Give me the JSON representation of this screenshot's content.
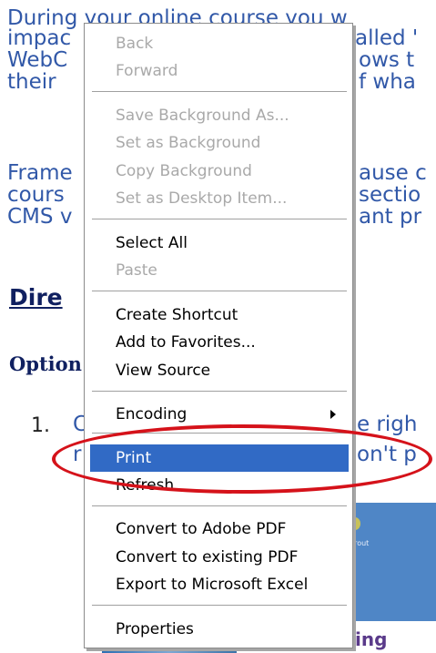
{
  "background_page": {
    "paragraph1_lines": [
      "During your online course you w",
      "impac",
      "WebC",
      "their"
    ],
    "paragraph1_right": [
      "alled '",
      "ows t",
      "f wha"
    ],
    "paragraph2_lines": [
      "Frame",
      "cours",
      "CMS v"
    ],
    "paragraph2_right": [
      "ause c",
      "sectio",
      "ant pr"
    ],
    "heading": "Dire",
    "subheading": "Option",
    "list_number": "1.",
    "list_first_letter": "C",
    "list_line1_right": "e righ",
    "list_line2_left": "r",
    "list_line2_right": "on't p",
    "image_caption": "grout",
    "footer_text": "ing"
  },
  "context_menu": {
    "items": [
      {
        "label": "Back",
        "disabled": true
      },
      {
        "label": "Forward",
        "disabled": true
      },
      {
        "label": "Save Background As...",
        "disabled": true
      },
      {
        "label": "Set as Background",
        "disabled": true
      },
      {
        "label": "Copy Background",
        "disabled": true
      },
      {
        "label": "Set as Desktop Item...",
        "disabled": true
      },
      {
        "label": "Select All",
        "disabled": false
      },
      {
        "label": "Paste",
        "disabled": true
      },
      {
        "label": "Create Shortcut",
        "disabled": false
      },
      {
        "label": "Add to Favorites...",
        "disabled": false
      },
      {
        "label": "View Source",
        "disabled": false
      },
      {
        "label": "Encoding",
        "disabled": false,
        "has_submenu": true
      },
      {
        "label": "Print",
        "disabled": false,
        "selected": true
      },
      {
        "label": "Refresh",
        "disabled": false
      },
      {
        "label": "Convert to Adobe PDF",
        "disabled": false
      },
      {
        "label": "Convert to existing PDF",
        "disabled": false
      },
      {
        "label": "Export to Microsoft Excel",
        "disabled": false
      },
      {
        "label": "Properties",
        "disabled": false
      }
    ],
    "selected_item": "Print"
  },
  "colors": {
    "menu_selection": "#316ac5",
    "highlight_ellipse": "#d5121a",
    "link_text": "#3158a8",
    "disabled_text": "#a9a9a9"
  }
}
